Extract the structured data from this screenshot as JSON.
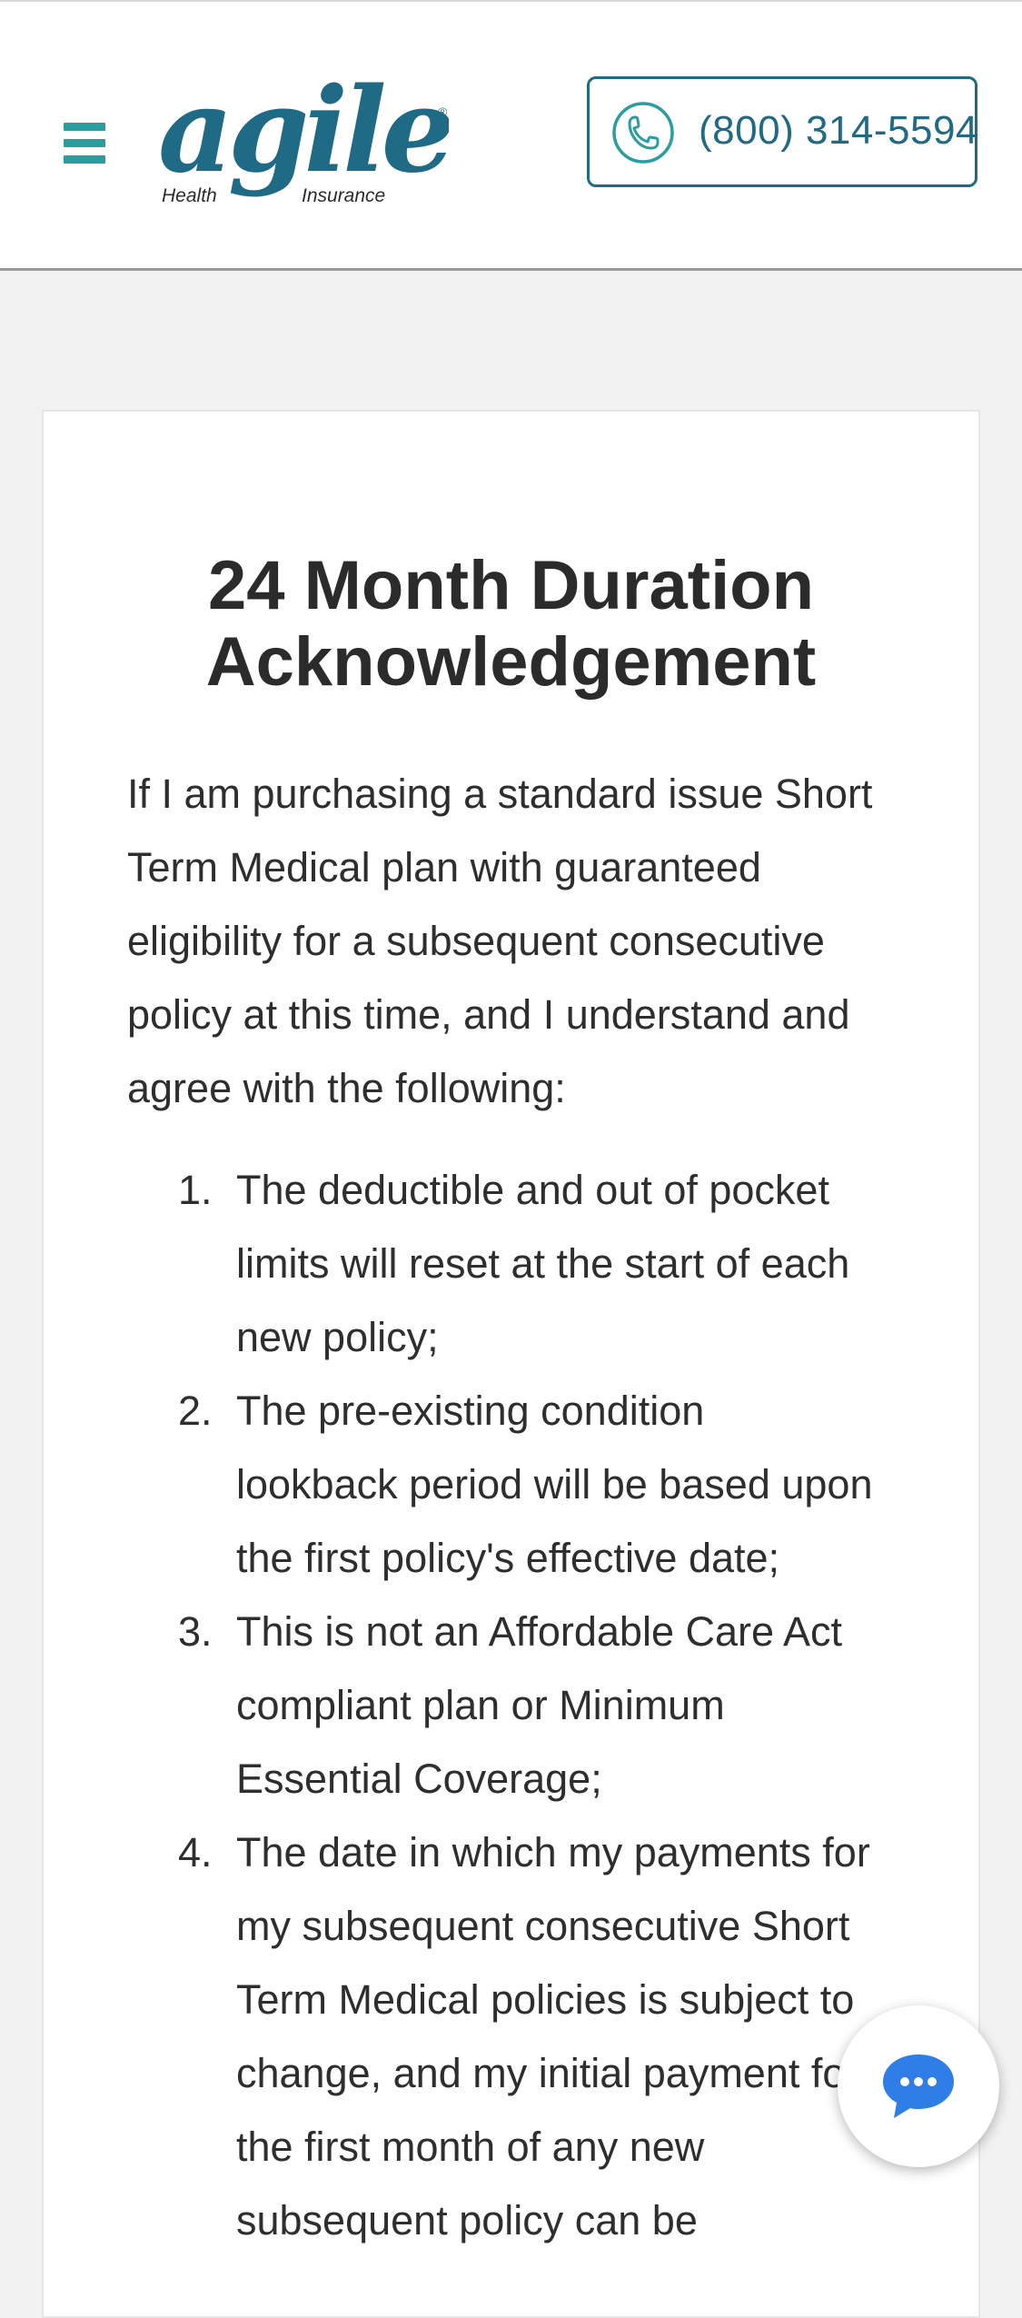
{
  "header": {
    "logo": {
      "wordmark": "agile",
      "left_text": "Health",
      "right_text": "Insurance",
      "registered_mark": "®"
    },
    "phone_number": "(800) 314-5594"
  },
  "colors": {
    "brand_teal": "#2a9d9e",
    "phone_blue": "#1f6a85",
    "chat_blue": "#2f7ee8"
  },
  "icons": {
    "menu": "hamburger-menu-icon",
    "phone": "phone-icon",
    "chat": "chat-bubble-icon"
  },
  "card": {
    "title_line1": "24 Month Duration",
    "title_line2": "Acknowledgement",
    "intro_lines": [
      "If I am purchasing a standard issue Short",
      "Term Medical plan with guaranteed",
      "eligibility for a subsequent consecutive",
      "policy at this time, and I understand and",
      "agree with the following:"
    ],
    "items": [
      {
        "number": "1.",
        "lines": [
          "The deductible and out of pocket",
          "limits will reset at the start of each",
          "new policy;"
        ]
      },
      {
        "number": "2.",
        "lines": [
          "The pre-existing condition",
          "lookback period will be based upon",
          "the first policy's effective date;"
        ]
      },
      {
        "number": "3.",
        "lines": [
          "This is not an Affordable Care Act",
          "compliant plan or Minimum",
          "Essential Coverage;"
        ]
      },
      {
        "number": "4.",
        "lines": [
          "The date in which my payments for",
          "my subsequent consecutive Short",
          "Term Medical policies is subject to",
          "change, and my initial payment for",
          "the first month of any new",
          "subsequent policy can be"
        ]
      }
    ]
  }
}
